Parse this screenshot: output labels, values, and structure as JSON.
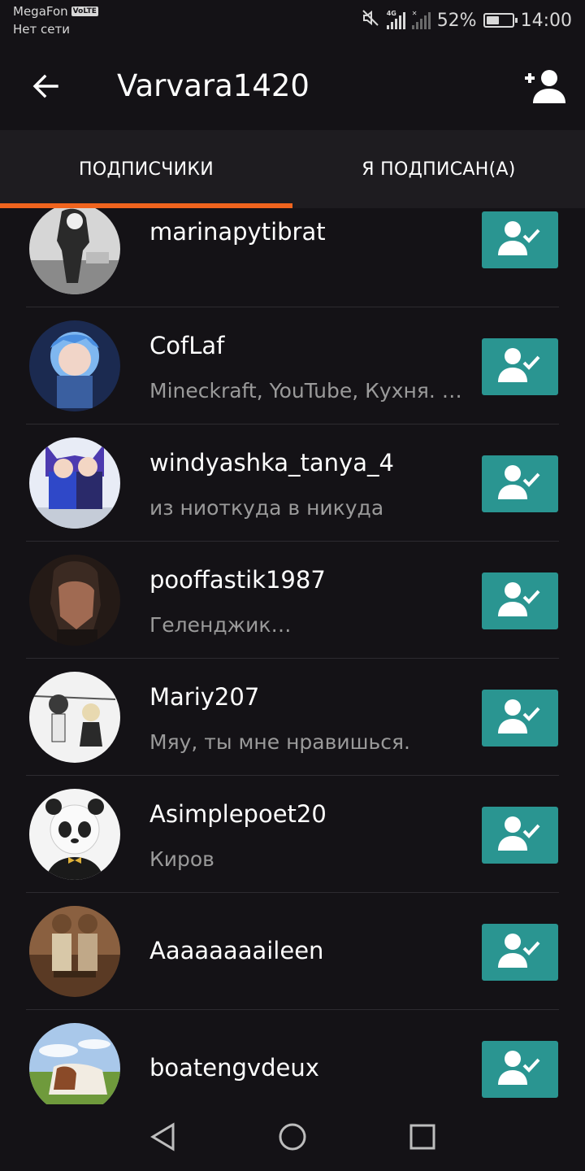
{
  "status_bar": {
    "carrier": "MegaFon",
    "volte_badge": "VoLTE",
    "network_status": "Нет сети",
    "network_type": "4G",
    "battery_percent": "52%",
    "battery_level": 0.52,
    "time": "14:00",
    "icons": [
      "mute-icon",
      "signal-icon",
      "battery-icon"
    ]
  },
  "toolbar": {
    "title": "Varvara1420",
    "back_icon": "arrow-left-icon",
    "add_friend_icon": "add-user-icon"
  },
  "tabs": [
    {
      "label": "ПОДПИСЧИКИ",
      "active": true
    },
    {
      "label": "Я ПОДПИСАН(А)",
      "active": false
    }
  ],
  "colors": {
    "accent": "#f0641e",
    "follow_button": "#2a9591",
    "background": "#141216"
  },
  "users": [
    {
      "name": "marinapytibrat",
      "subtitle": ""
    },
    {
      "name": "CofLaf",
      "subtitle": "Mineckraft, YouTube, Кухня. Б…"
    },
    {
      "name": "windyashka_tanya_4",
      "subtitle": "из ниоткуда в никуда"
    },
    {
      "name": "pooffastik1987",
      "subtitle": "Геленджик…"
    },
    {
      "name": "Mariy207",
      "subtitle": "Мяу, ты мне нравишься."
    },
    {
      "name": "Asimplepoet20",
      "subtitle": "Киров"
    },
    {
      "name": "Aaaaaaaaileen",
      "subtitle": ""
    },
    {
      "name": "boatengvdeux",
      "subtitle": ""
    }
  ],
  "nav_bar": {
    "icons": [
      "back-triangle-icon",
      "home-circle-icon",
      "recents-square-icon"
    ]
  }
}
